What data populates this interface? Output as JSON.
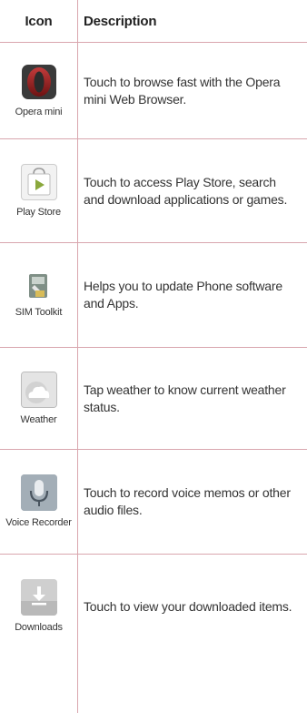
{
  "header": {
    "icon_col": "Icon",
    "desc_col": "Description"
  },
  "rows": [
    {
      "icon_name": "opera-mini-icon",
      "label": "Opera mini",
      "description": "Touch to browse fast with the Opera mini Web Browser."
    },
    {
      "icon_name": "play-store-icon",
      "label": "Play Store",
      "description": "Touch to access Play Store, search and download applications or games."
    },
    {
      "icon_name": "sim-toolkit-icon",
      "label": "SIM Toolkit",
      "description": "Helps you to update Phone software and Apps."
    },
    {
      "icon_name": "weather-icon",
      "label": "Weather",
      "description": "Tap weather to know current weather status."
    },
    {
      "icon_name": "voice-recorder-icon",
      "label": "Voice Recorder",
      "description": "Touch to record voice memos or other audio files."
    },
    {
      "icon_name": "downloads-icon",
      "label": "Downloads",
      "description": "Touch to view your downloaded items."
    }
  ],
  "colors": {
    "rule": "#d9a6ae",
    "text": "#333333"
  }
}
